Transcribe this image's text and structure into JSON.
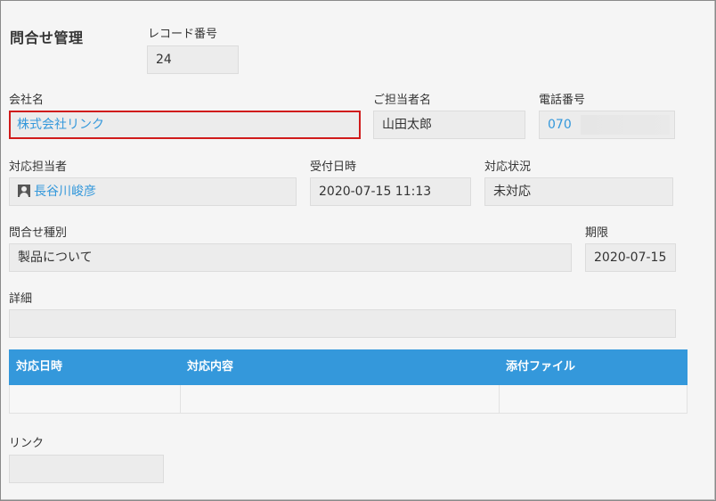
{
  "app": {
    "title": "問合せ管理"
  },
  "fields": {
    "record_number": {
      "label": "レコード番号",
      "value": "24"
    },
    "company": {
      "label": "会社名",
      "value": "株式会社リンク"
    },
    "contact_person": {
      "label": "ご担当者名",
      "value": "山田太郎"
    },
    "phone": {
      "label": "電話番号",
      "value": "070"
    },
    "assignee": {
      "label": "対応担当者",
      "value": "長谷川峻彦"
    },
    "received_at": {
      "label": "受付日時",
      "value": "2020-07-15 11:13"
    },
    "status": {
      "label": "対応状況",
      "value": "未対応"
    },
    "inquiry_type": {
      "label": "問合せ種別",
      "value": "製品について"
    },
    "deadline": {
      "label": "期限",
      "value": "2020-07-15"
    },
    "detail": {
      "label": "詳細",
      "value": ""
    },
    "link": {
      "label": "リンク",
      "value": ""
    }
  },
  "table": {
    "headers": [
      "対応日時",
      "対応内容",
      "添付ファイル"
    ]
  },
  "colors": {
    "accent": "#3498db",
    "highlight_border": "#d01b1b",
    "field_bg": "#ececec",
    "page_bg": "#f5f5f5"
  },
  "icons": {
    "assignee": "user-icon"
  }
}
